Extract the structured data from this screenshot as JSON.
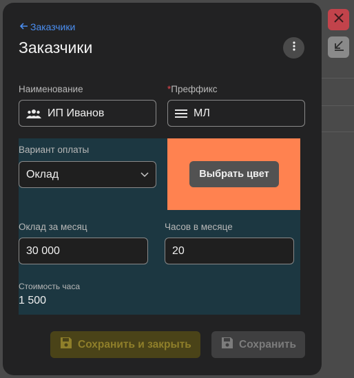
{
  "window_controls": {
    "close_icon": "close-icon",
    "collapse_icon": "arrow-down-left-icon"
  },
  "dialog": {
    "back_link": "Заказчики",
    "title": "Заказчики",
    "menu_icon": "more-vertical-icon"
  },
  "form": {
    "name": {
      "label": "Наименование",
      "value": "ИП Иванов",
      "icon": "people-icon"
    },
    "prefix": {
      "required_mark": "*",
      "label": "Преффикс",
      "value": "МЛ",
      "icon": "menu-lines-icon"
    },
    "payment": {
      "label": "Вариант оплаты",
      "value": "Оклад",
      "icon": "chevron-down-icon"
    },
    "color_button": "Выбрать цвет",
    "accent_color": "#ff8250",
    "monthly_salary": {
      "label": "Оклад за месяц",
      "value": "30 000"
    },
    "hours_per_month": {
      "label": "Часов в месяце",
      "value": "20"
    },
    "hour_cost": {
      "label": "Стоимость часа",
      "value": "1 500"
    }
  },
  "footer": {
    "save_close_label": "Сохранить и закрыть",
    "save_label": "Сохранить",
    "save_icon": "floppy-disk-icon"
  }
}
